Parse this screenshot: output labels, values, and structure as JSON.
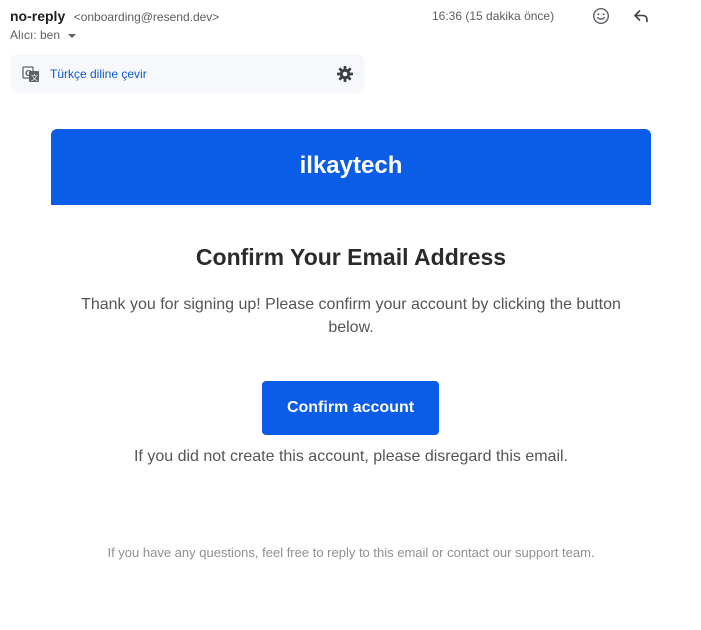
{
  "header": {
    "sender_name": "no-reply",
    "sender_email": "<onboarding@resend.dev>",
    "recipient_label": "Alıcı: ben",
    "timestamp": "16:36 (15 dakika önce)",
    "icons": {
      "emoji": "add-reaction-icon",
      "reply": "reply-icon",
      "more": "more-vert-icon"
    }
  },
  "translate_bar": {
    "icon": "translate-icon",
    "link_label": "Türkçe diline çevir",
    "settings_icon": "gear-icon"
  },
  "email": {
    "brand_name": "ilkaytech",
    "brand_color": "#0b5ce6",
    "title": "Confirm Your Email Address",
    "intro": "Thank you for signing up! Please confirm your account by clicking the button below.",
    "button_label": "Confirm account",
    "disregard_text": "If you did not create this account, please disregard this email.",
    "footer_text": "If you have any questions, feel free to reply to this email or contact our support team."
  }
}
